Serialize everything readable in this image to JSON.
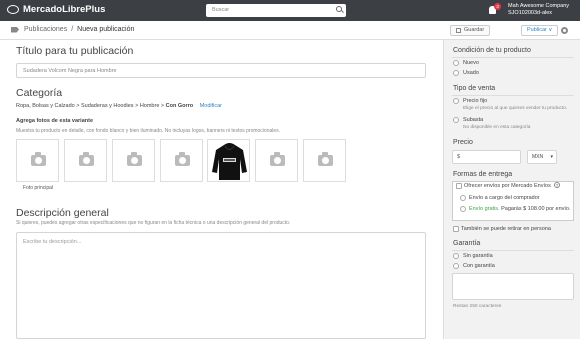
{
  "topbar": {
    "logo": "MercadoLibrePlus",
    "search_placeholder": "Buscar",
    "notification_count": "3",
    "account_name": "Mah Awesome Company",
    "account_id": "SJO102003d-alex"
  },
  "subbar": {
    "breadcrumb": [
      "Publicaciones",
      "/",
      "Nueva publicación"
    ],
    "save_label": "Guardar",
    "publish_label": "Publicar ∨"
  },
  "main": {
    "title_heading": "Título para tu publicación",
    "title_value": "Sudadera Volcom Negra para Hombre",
    "category_heading": "Categoría",
    "category_path": "Ropa, Bolsas y Calzado > Sudaderas y Hoodies > Hombre > ",
    "category_current": "Con Gorro",
    "category_modify": "Modificar",
    "photos_heading": "Agrega fotos de esta variante",
    "photos_hint": "Muestra tu producto en detalle, con fondo blanco y bien iluminado. No incluyas logos, banners ni textos promocionales.",
    "main_photo_label": "Foto principal",
    "description_heading": "Descripción general",
    "description_hint": "Si quieres, puedes agregar otras especificaciones que no figuran en la ficha técnica o una descripción general del producto.",
    "description_placeholder": "Escribe tu descripción..."
  },
  "sidebar": {
    "condition_heading": "Condición de tu producto",
    "condition_options": [
      "Nuevo",
      "Usado"
    ],
    "sale_type_heading": "Tipo de venta",
    "sale_fixed": "Precio fijo",
    "sale_fixed_hint": "Elige el precio al que quieres vender tu producto.",
    "sale_auction": "Subasta",
    "sale_auction_hint": "No disponible en esta categoría",
    "price_heading": "Precio",
    "price_prefix": "$",
    "currency": "MXN",
    "delivery_heading": "Formas de entrega",
    "delivery_mercado": "Ofrecer envíos por Mercado Envíos",
    "delivery_buyer": "Envío a cargo del comprador",
    "delivery_free": "Envío gratis.",
    "delivery_free_detail": " Pagarás $ 108.00 por envío.",
    "pickup": "También se puede retirar en persona",
    "warranty_heading": "Garantía",
    "warranty_options": [
      "Sin garantía",
      "Con garantía"
    ],
    "chars_left": "Restan 250 caracteres"
  },
  "colors": {
    "topbar": "#3c4044",
    "link": "#2f84c8",
    "badge": "#e0394a",
    "free_shipping": "#3aa547"
  }
}
